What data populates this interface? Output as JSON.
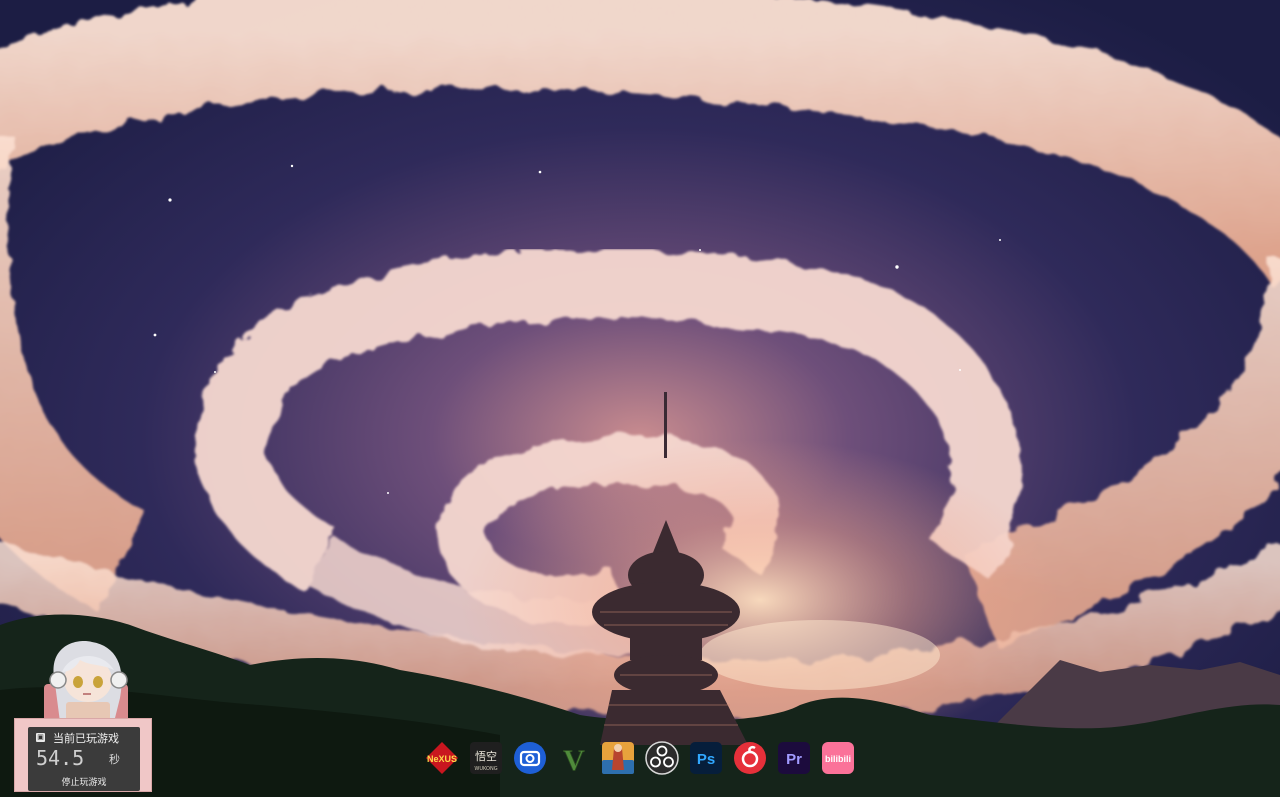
{
  "wallpaper": {
    "description_icon": "spiral-cloud-sky-tower-wallpaper",
    "colors": {
      "sky_top": "#1e1f47",
      "sky_mid": "#3b2d61",
      "cloud": "#f3cfc0",
      "glow": "#ffd7b0",
      "ground": "#0f1d0f"
    }
  },
  "game_timer_widget": {
    "title": "当前已玩游戏",
    "value": "54.5",
    "unit": "秒",
    "stop_label": "停止玩游戏",
    "mascot_icon": "anime-girl-headphones-mascot",
    "panel_color": "#f0c7c7"
  },
  "dock": {
    "items": [
      {
        "name": "Nexus",
        "label": "NeXUS",
        "icon": "nexus-icon"
      },
      {
        "name": "Black Myth Wukong",
        "label": "悟空",
        "sublabel": "WUKONG",
        "icon": "wukong-icon"
      },
      {
        "name": "Camera",
        "label": "",
        "icon": "camera-icon"
      },
      {
        "name": "GTA V",
        "label": "V",
        "icon": "gta-v-icon"
      },
      {
        "name": "Game",
        "label": "",
        "icon": "game-art-icon"
      },
      {
        "name": "OBS",
        "label": "",
        "icon": "obs-icon"
      },
      {
        "name": "Photoshop",
        "label": "Ps",
        "icon": "photoshop-icon"
      },
      {
        "name": "NetEase Music",
        "label": "",
        "icon": "netease-music-icon"
      },
      {
        "name": "Premiere",
        "label": "Pr",
        "icon": "premiere-icon"
      },
      {
        "name": "bilibili",
        "label": "bilibili",
        "icon": "bilibili-icon"
      }
    ]
  }
}
